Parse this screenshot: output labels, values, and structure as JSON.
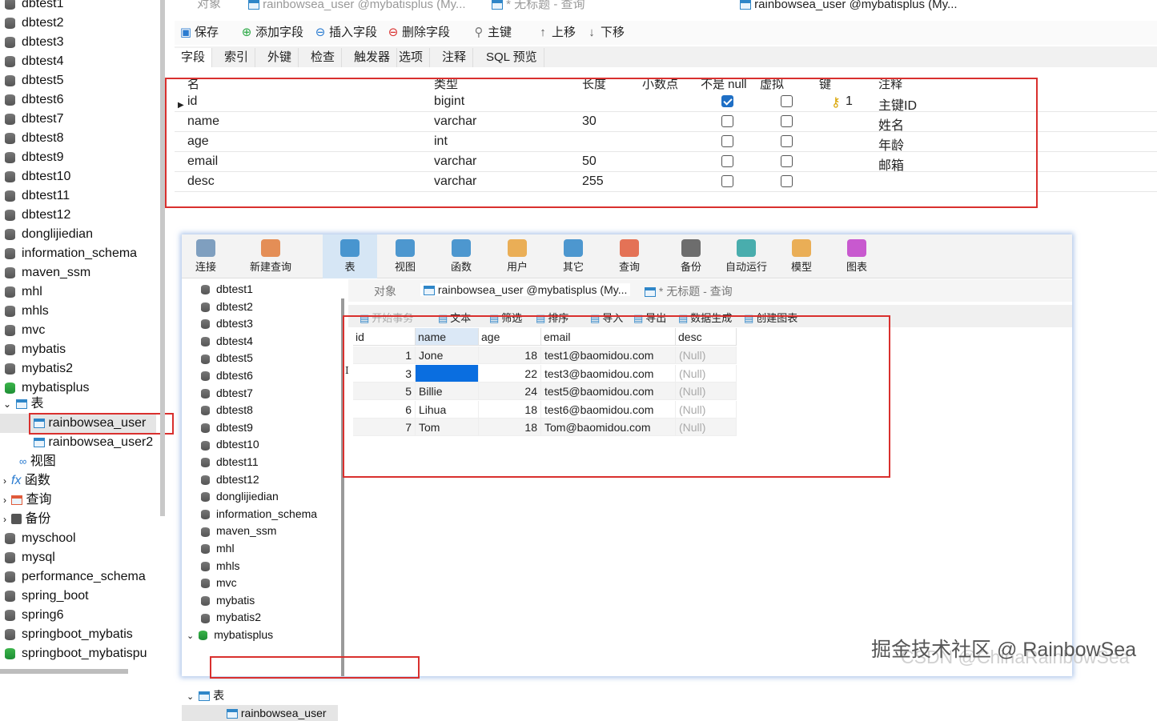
{
  "left_tree": {
    "items": [
      "dbtest1",
      "dbtest2",
      "dbtest3",
      "dbtest4",
      "dbtest5",
      "dbtest6",
      "dbtest7",
      "dbtest8",
      "dbtest9",
      "dbtest10",
      "dbtest11",
      "dbtest12",
      "donglijiedian",
      "information_schema",
      "maven_ssm",
      "mhl",
      "mhls",
      "mvc",
      "mybatis",
      "mybatis2",
      "mybatisplus"
    ],
    "tables_label": "表",
    "table1": "rainbowsea_user",
    "table2": "rainbowsea_user2",
    "views": "视图",
    "functions": "函数",
    "queries": "查询",
    "backups": "备份",
    "items_after": [
      "myschool",
      "mysql",
      "performance_schema",
      "spring_boot",
      "spring6",
      "springboot_mybatis",
      "springboot_mybatispu"
    ]
  },
  "designer": {
    "top_tabs": [
      "对象",
      "rainbowsea_user @mybatisplus (My...",
      "* 无标题 - 查询",
      "rainbowsea_user @mybatisplus (My..."
    ],
    "toolbar": {
      "save": "保存",
      "add_field": "添加字段",
      "insert_field": "插入字段",
      "delete_field": "删除字段",
      "primary_key": "主键",
      "move_up": "上移",
      "move_down": "下移"
    },
    "subtabs": [
      "字段",
      "索引",
      "外键",
      "检查",
      "触发器",
      "选项",
      "注释",
      "SQL 预览"
    ],
    "columns": [
      "名",
      "类型",
      "长度",
      "小数点",
      "不是 null",
      "虚拟",
      "键",
      "注释"
    ],
    "rows": [
      {
        "name": "id",
        "type": "bigint",
        "length": "",
        "not_null": true,
        "key": "1",
        "comment": "主键ID"
      },
      {
        "name": "name",
        "type": "varchar",
        "length": "30",
        "not_null": false,
        "key": "",
        "comment": "姓名"
      },
      {
        "name": "age",
        "type": "int",
        "length": "",
        "not_null": false,
        "key": "",
        "comment": "年龄"
      },
      {
        "name": "email",
        "type": "varchar",
        "length": "50",
        "not_null": false,
        "key": "",
        "comment": "邮箱"
      },
      {
        "name": "desc",
        "type": "varchar",
        "length": "255",
        "not_null": false,
        "key": "",
        "comment": ""
      }
    ]
  },
  "inner": {
    "ribbon": [
      "连接",
      "新建查询",
      "表",
      "视图",
      "函数",
      "用户",
      "其它",
      "查询",
      "备份",
      "自动运行",
      "模型",
      "图表"
    ],
    "tree": [
      "dbtest1",
      "dbtest2",
      "dbtest3",
      "dbtest4",
      "dbtest5",
      "dbtest6",
      "dbtest7",
      "dbtest8",
      "dbtest9",
      "dbtest10",
      "dbtest11",
      "dbtest12",
      "donglijiedian",
      "information_schema",
      "maven_ssm",
      "mhl",
      "mhls",
      "mvc",
      "mybatis",
      "mybatis2",
      "mybatisplus"
    ],
    "tree_tables": "表",
    "tree_table1": "rainbowsea_user",
    "tabs": [
      "对象",
      "rainbowsea_user @mybatisplus (My...",
      "* 无标题 - 查询"
    ],
    "grid_toolbar": [
      "开始事务",
      "文本",
      "筛选",
      "排序",
      "导入",
      "导出",
      "数据生成",
      "创建图表"
    ],
    "result_columns": [
      "id",
      "name",
      "age",
      "email",
      "desc"
    ],
    "result_rows": [
      {
        "id": "1",
        "name": "Jone",
        "age": "18",
        "email": "test1@baomidou.com",
        "desc": "(Null)"
      },
      {
        "id": "3",
        "name": "",
        "age": "22",
        "email": "test3@baomidou.com",
        "desc": "(Null)"
      },
      {
        "id": "5",
        "name": "Billie",
        "age": "24",
        "email": "test5@baomidou.com",
        "desc": "(Null)"
      },
      {
        "id": "6",
        "name": "Lihua",
        "age": "18",
        "email": "test6@baomidou.com",
        "desc": "(Null)"
      },
      {
        "id": "7",
        "name": "Tom",
        "age": "18",
        "email": "Tom@baomidou.com",
        "desc": "(Null)"
      }
    ],
    "row_marker": "I"
  },
  "watermark": "掘金技术社区 @ RainbowSea",
  "watermark2": "CSDN @ChinaRainbowSea",
  "colors": {
    "highlight_red": "#d9302e",
    "selection_blue": "#0a6ee0"
  }
}
